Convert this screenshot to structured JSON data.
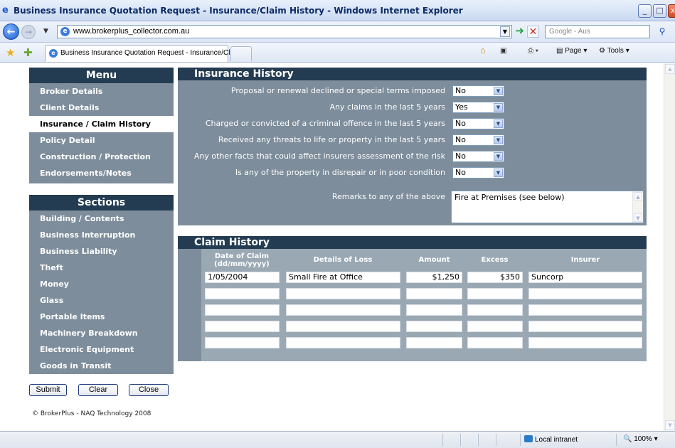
{
  "window": {
    "title": "Business Insurance Quotation Request - Insurance/Claim History - Windows Internet Explorer"
  },
  "browser": {
    "url": "www.brokerplus_collector.com.au",
    "search_placeholder": "Google - Aus",
    "tab_label": "Business Insurance Quotation Request - Insurance/Cl...",
    "page_menu": "Page",
    "tools_menu": "Tools"
  },
  "menu": {
    "heading": "Menu",
    "items": [
      "Broker Details",
      "Client Details",
      "Insurance / Claim History",
      "Policy Detail",
      "Construction / Protection",
      "Endorsements/Notes"
    ]
  },
  "sections": {
    "heading": "Sections",
    "items": [
      "Building / Contents",
      "Business Interruption",
      "Business Liability",
      "Theft",
      "Money",
      "Glass",
      "Portable Items",
      "Machinery Breakdown",
      "Electronic Equipment",
      "Goods in Transit"
    ]
  },
  "buttons": {
    "submit": "Submit",
    "clear": "Clear",
    "close": "Close"
  },
  "footer": "© BrokerPlus - NAQ Technology 2008",
  "insurance_history": {
    "heading": "Insurance History",
    "questions": [
      {
        "label": "Proposal or renewal declined or special terms imposed",
        "value": "No"
      },
      {
        "label": "Any claims in the last 5 years",
        "value": "Yes"
      },
      {
        "label": "Charged or convicted of a criminal offence in the last 5 years",
        "value": "No"
      },
      {
        "label": "Received any threats to life or property in the last 5 years",
        "value": "No"
      },
      {
        "label": "Any other facts that could affect insurers assessment of the risk",
        "value": "No"
      },
      {
        "label": "Is any of the property in disrepair or in poor condition",
        "value": "No"
      }
    ],
    "remarks_label": "Remarks to any of the above",
    "remarks_value": "Fire at Premises (see below)"
  },
  "claim_history": {
    "heading": "Claim History",
    "columns": [
      "Date of Claim (dd/mm/yyyy)",
      "Details of Loss",
      "Amount",
      "Excess",
      "Insurer"
    ],
    "rows": [
      [
        "1/05/2004",
        "Small Fire at Office",
        "$1,250",
        "$350",
        "Suncorp"
      ],
      [
        "",
        "",
        "",
        "",
        ""
      ],
      [
        "",
        "",
        "",
        "",
        ""
      ],
      [
        "",
        "",
        "",
        "",
        ""
      ],
      [
        "",
        "",
        "",
        "",
        ""
      ]
    ]
  },
  "status": {
    "zone": "Local intranet",
    "zoom": "100%"
  }
}
